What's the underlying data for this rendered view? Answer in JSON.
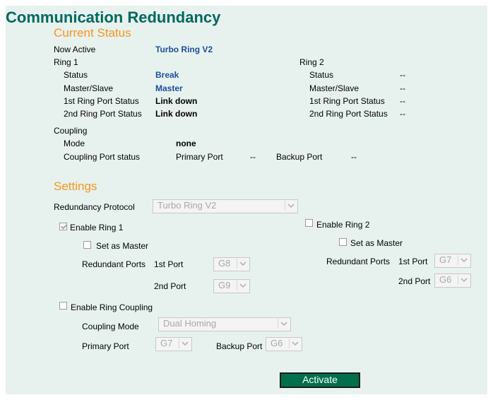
{
  "page_title": "Communication Redundancy",
  "current_status": {
    "heading": "Current Status",
    "now_active_label": "Now Active",
    "now_active_value": "Turbo Ring V2",
    "ring1": {
      "label": "Ring 1",
      "status_label": "Status",
      "status_value": "Break",
      "master_slave_label": "Master/Slave",
      "master_slave_value": "Master",
      "port1_label": "1st Ring Port Status",
      "port1_value": "Link down",
      "port2_label": "2nd Ring Port Status",
      "port2_value": "Link down"
    },
    "ring2": {
      "label": "Ring 2",
      "status_label": "Status",
      "status_value": "--",
      "master_slave_label": "Master/Slave",
      "master_slave_value": "--",
      "port1_label": "1st Ring Port Status",
      "port1_value": "--",
      "port2_label": "2nd Ring Port Status",
      "port2_value": "--"
    },
    "coupling": {
      "label": "Coupling",
      "mode_label": "Mode",
      "mode_value": "none",
      "port_status_label": "Coupling Port status",
      "primary_port_label": "Primary Port",
      "primary_port_value": "--",
      "backup_port_label": "Backup Port",
      "backup_port_value": "--"
    }
  },
  "settings": {
    "heading": "Settings",
    "protocol_label": "Redundancy Protocol",
    "protocol_value": "Turbo Ring V2",
    "ring1": {
      "enable_label": "Enable Ring 1",
      "enabled": true,
      "set_master_label": "Set as Master",
      "set_master": false,
      "redundant_ports_label": "Redundant Ports",
      "port1_label": "1st Port",
      "port1_value": "G8",
      "port2_label": "2nd Port",
      "port2_value": "G9"
    },
    "ring2": {
      "enable_label": "Enable Ring 2",
      "enabled": false,
      "set_master_label": "Set as Master",
      "set_master": false,
      "redundant_ports_label": "Redundant Ports",
      "port1_label": "1st Port",
      "port1_value": "G7",
      "port2_label": "2nd Port",
      "port2_value": "G6"
    },
    "coupling": {
      "enable_label": "Enable Ring Coupling",
      "enabled": false,
      "mode_label": "Coupling Mode",
      "mode_value": "Dual Homing",
      "primary_port_label": "Primary Port",
      "primary_port_value": "G7",
      "backup_port_label": "Backup Port",
      "backup_port_value": "G6"
    }
  },
  "activate_label": "Activate",
  "colors": {
    "title": "#00695c",
    "section": "#f7941d",
    "value_blue": "#1c4e9b",
    "panel": "#e7f2ee",
    "button": "#006f4c"
  },
  "icons": {
    "dropdown": "chevron-down-icon",
    "checkbox_check": "check-icon"
  }
}
